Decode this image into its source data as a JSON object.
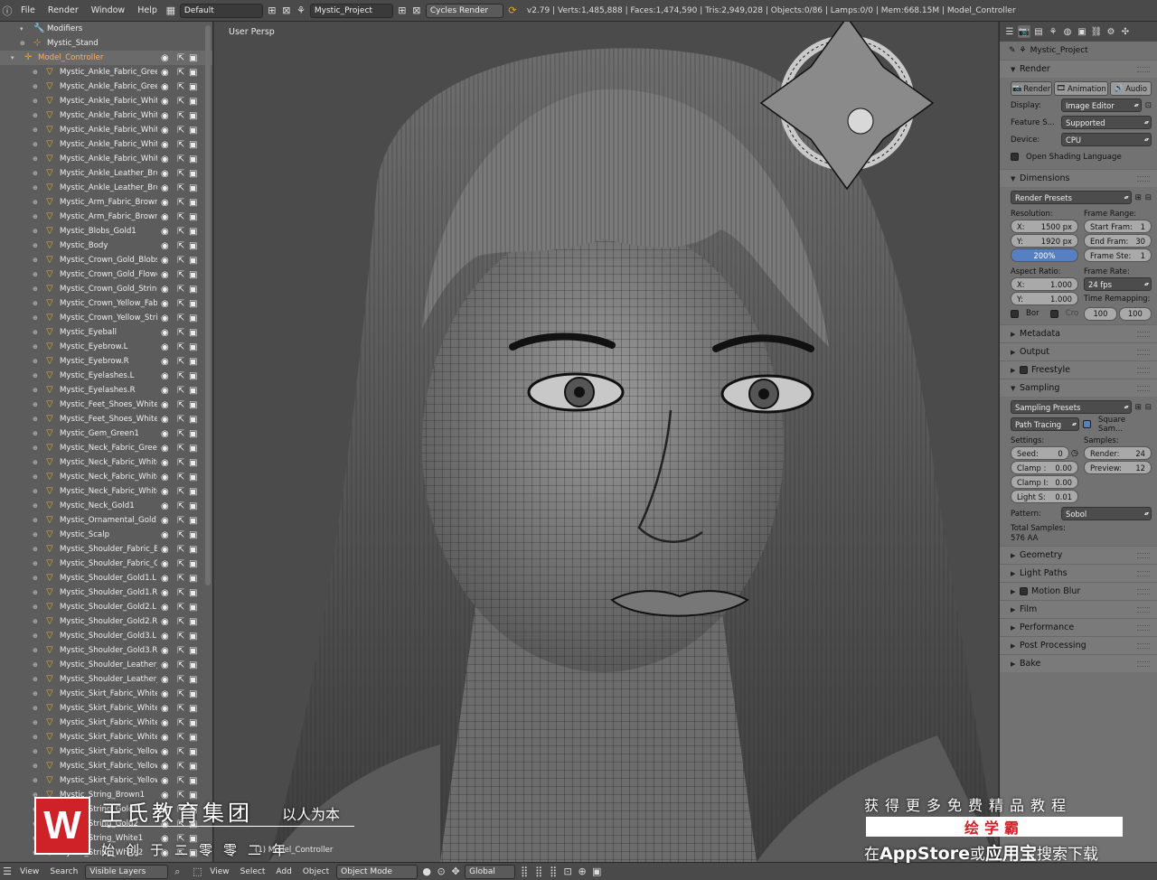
{
  "topbar": {
    "menus": [
      "File",
      "Render",
      "Window",
      "Help"
    ],
    "screen_layout": "Default",
    "scene": "Mystic_Project",
    "engine": "Cycles Render",
    "stats": "v2.79 | Verts:1,485,888 | Faces:1,474,590 | Tris:2,949,028 | Objects:0/86 | Lamps:0/0 | Mem:668.15M | Model_Controller"
  },
  "outliner": {
    "top_rows": [
      {
        "label": "Modifiers",
        "kind": "wrench"
      },
      {
        "label": "Mystic_Stand",
        "kind": "mesh"
      },
      {
        "label": "Model_Controller",
        "kind": "empty"
      }
    ],
    "items": [
      "Mystic_Ankle_Fabric_Green",
      "Mystic_Ankle_Fabric_Green",
      "Mystic_Ankle_Fabric_White",
      "Mystic_Ankle_Fabric_White",
      "Mystic_Ankle_Fabric_White",
      "Mystic_Ankle_Fabric_White",
      "Mystic_Ankle_Fabric_White",
      "Mystic_Ankle_Leather_Brov",
      "Mystic_Ankle_Leather_Brov",
      "Mystic_Arm_Fabric_Brown1",
      "Mystic_Arm_Fabric_Brown1",
      "Mystic_Blobs_Gold1",
      "Mystic_Body",
      "Mystic_Crown_Gold_Blobs",
      "Mystic_Crown_Gold_Flower",
      "Mystic_Crown_Gold_String",
      "Mystic_Crown_Yellow_Fabri",
      "Mystic_Crown_Yellow_Strin",
      "Mystic_Eyeball",
      "Mystic_Eyebrow.L",
      "Mystic_Eyebrow.R",
      "Mystic_Eyelashes.L",
      "Mystic_Eyelashes.R",
      "Mystic_Feet_Shoes_White.L",
      "Mystic_Feet_Shoes_White.R",
      "Mystic_Gem_Green1",
      "Mystic_Neck_Fabric_Green1",
      "Mystic_Neck_Fabric_White1",
      "Mystic_Neck_Fabric_White2",
      "Mystic_Neck_Fabric_White3",
      "Mystic_Neck_Gold1",
      "Mystic_Ornamental_Gold1",
      "Mystic_Scalp",
      "Mystic_Shoulder_Fabric_Brc",
      "Mystic_Shoulder_Fabric_Gre",
      "Mystic_Shoulder_Gold1.L",
      "Mystic_Shoulder_Gold1.R",
      "Mystic_Shoulder_Gold2.L",
      "Mystic_Shoulder_Gold2.R",
      "Mystic_Shoulder_Gold3.L",
      "Mystic_Shoulder_Gold3.R",
      "Mystic_Shoulder_Leather_B",
      "Mystic_Shoulder_Leather_B",
      "Mystic_Skirt_Fabric_White1",
      "Mystic_Skirt_Fabric_White2",
      "Mystic_Skirt_Fabric_White2",
      "Mystic_Skirt_Fabric_White3",
      "Mystic_Skirt_Fabric_Yellow1",
      "Mystic_Skirt_Fabric_Yellow2",
      "Mystic_Skirt_Fabric_Yellow3",
      "Mystic_String_Brown1",
      "Mystic_String_Gold1",
      "Mystic_String_Gold2",
      "Mystic_String_White1",
      "Mystic_String_White2"
    ]
  },
  "viewport": {
    "label": "User Persp",
    "object_label": "(1) Model_Controller"
  },
  "properties": {
    "breadcrumb": "Mystic_Project",
    "render": {
      "title": "Render",
      "buttons": [
        "Render",
        "Animation",
        "Audio"
      ],
      "display_label": "Display:",
      "display_value": "Image Editor",
      "feature_label": "Feature S...",
      "feature_value": "Supported",
      "device_label": "Device:",
      "device_value": "CPU",
      "osl_label": "Open Shading Language"
    },
    "dimensions": {
      "title": "Dimensions",
      "presets": "Render Presets",
      "resolution_label": "Resolution:",
      "res_x": "1500 px",
      "res_y": "1920 px",
      "res_pct": "200%",
      "frame_range_label": "Frame Range:",
      "start": "1",
      "end": "30",
      "step": "1",
      "start_label": "Start Fram:",
      "end_label": "End Fram:",
      "step_label": "Frame Ste:",
      "aspect_label": "Aspect Ratio:",
      "aspect_x": "1.000",
      "aspect_y": "1.000",
      "framerate_label": "Frame Rate:",
      "framerate": "24 fps",
      "remap_label": "Time Remapping:",
      "remap_old": "100",
      "remap_new": "100",
      "border_label": "Bor",
      "crop_label": "Cro"
    },
    "collapsed_a": [
      "Metadata",
      "Output",
      "Freestyle"
    ],
    "sampling": {
      "title": "Sampling",
      "presets": "Sampling Presets",
      "integrator": "Path Tracing",
      "square_label": "Square Sam...",
      "settings_label": "Settings:",
      "samples_label": "Samples:",
      "seed_label": "Seed:",
      "seed": "0",
      "clamp_d_label": "Clamp :",
      "clamp_d": "0.00",
      "clamp_i_label": "Clamp I:",
      "clamp_i": "0.00",
      "light_label": "Light S:",
      "light": "0.01",
      "render_label": "Render:",
      "render": "24",
      "preview_label": "Preview:",
      "preview": "12",
      "pattern_label": "Pattern:",
      "pattern": "Sobol",
      "total_label": "Total Samples:",
      "total": "576 AA"
    },
    "collapsed_b": [
      "Geometry",
      "Light Paths",
      "Motion Blur",
      "Film",
      "Performance",
      "Post Processing",
      "Bake"
    ]
  },
  "bottombar": {
    "left_menus": [
      "View",
      "Search"
    ],
    "filter": "Visible Layers",
    "vp_menus": [
      "View",
      "Select",
      "Add",
      "Object"
    ],
    "mode": "Object Mode",
    "orientation": "Global"
  },
  "watermark": {
    "logo": "W",
    "line1": "王氏教育集团",
    "line2": "以人为本",
    "line3": "始创于二零零二年",
    "right1": "获得更多免费精品教程",
    "right2": "绘学霸",
    "right3a": "在",
    "right3b": "AppStore",
    "right3c": "或",
    "right3d": "应用宝",
    "right3e": "搜索下载"
  },
  "colors": {
    "accent_blue": "#5680c2",
    "watermark_red": "#cf2128",
    "orange_text": "#ffb060"
  }
}
